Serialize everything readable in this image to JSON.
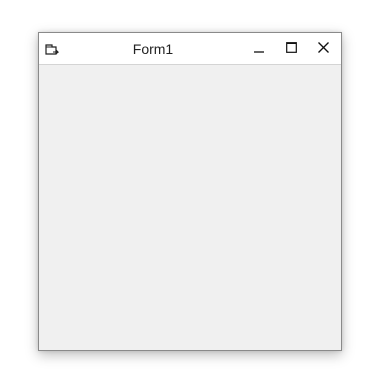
{
  "window": {
    "title": "Form1",
    "controls": {
      "minimize_icon": "minimize-icon",
      "maximize_icon": "maximize-icon",
      "close_icon": "close-icon"
    },
    "app_icon": "form-icon"
  },
  "colors": {
    "titlebar_bg": "#ffffff",
    "client_bg": "#f0f0f0",
    "border": "#8a8a8a"
  }
}
